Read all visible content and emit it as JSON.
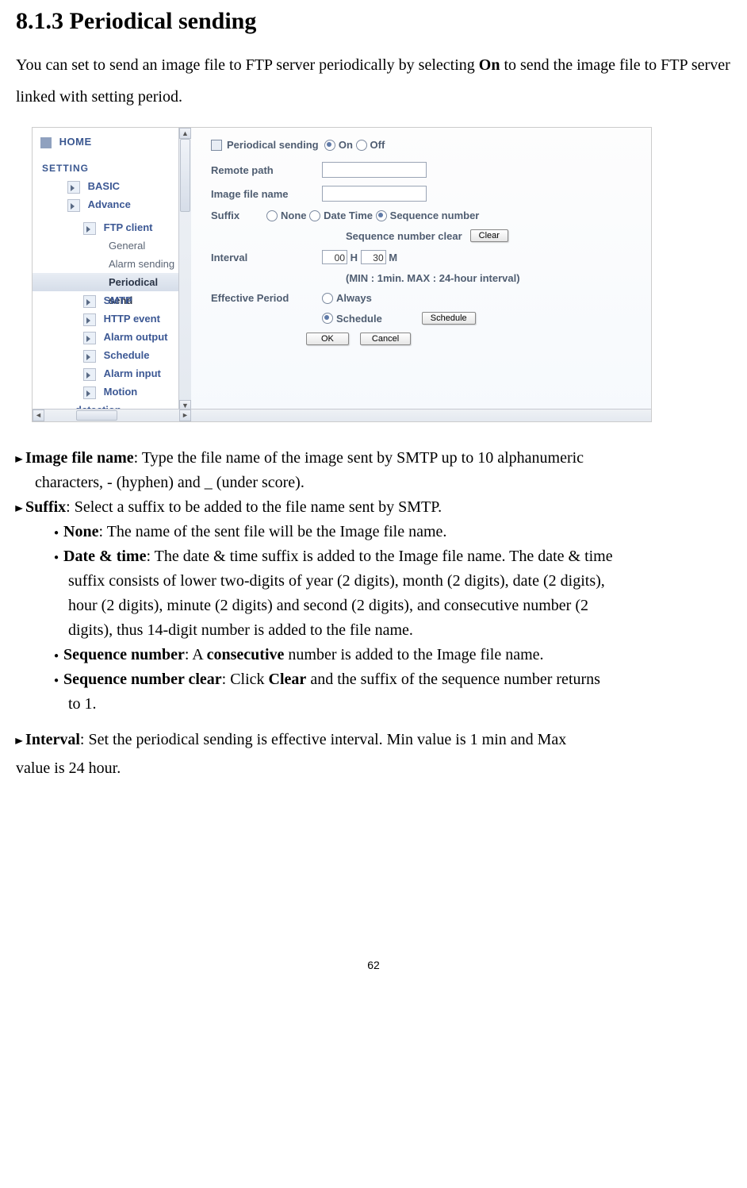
{
  "heading": "8.1.3 Periodical sending",
  "intro_parts": {
    "a": "You can set to send an image file to FTP server periodically by selecting ",
    "on": "On",
    "b": " to send the image file to FTP server linked with setting period."
  },
  "sidebar": {
    "home": "HOME",
    "setting": "SETTING",
    "basic": "BASIC",
    "advance": "Advance",
    "ftp_client": "FTP client",
    "general": "General",
    "alarm_sending": "Alarm sending",
    "periodical": "Periodical send",
    "smtp": "SMTP",
    "http_event": "HTTP event",
    "alarm_output": "Alarm output",
    "schedule": "Schedule",
    "alarm_input": "Alarm input",
    "motion": "Motion detection"
  },
  "content": {
    "title": "Periodical sending",
    "on": "On",
    "off": "Off",
    "remote_path": "Remote path",
    "image_file_name": "Image file name",
    "suffix": "Suffix",
    "none": "None",
    "date_time": "Date Time",
    "sequence_number": "Sequence number",
    "seq_clear_label": "Sequence number clear",
    "clear_btn": "Clear",
    "interval": "Interval",
    "h": "H",
    "m": "M",
    "hours_val": "00",
    "mins_val": "30",
    "range_hint": "(MIN : 1min. MAX : 24-hour interval)",
    "effective_period": "Effective Period",
    "always": "Always",
    "schedule": "Schedule",
    "schedule_btn": "Schedule",
    "ok": "OK",
    "cancel": "Cancel"
  },
  "desc": {
    "image_file_name_b": "Image file name",
    "image_file_name_t1": ": Type the file name of the image sent by SMTP up to 10 alphanumeric",
    "image_file_name_t2": "characters, - (hyphen) and _ (under score).",
    "suffix_b": "Suffix",
    "suffix_t": ": Select a suffix to be added to the file name sent by SMTP.",
    "none_b": "None",
    "none_t": ": The name of the sent file will be the Image file name.",
    "dt_b": "Date & time",
    "dt_t1": ": The date & time suffix is added to the Image file name. The date & time",
    "dt_t2": "suffix consists of lower two-digits of year (2 digits), month (2 digits), date (2 digits),",
    "dt_t3": "hour (2 digits), minute (2 digits) and second (2 digits), and consecutive number (2",
    "dt_t4": "digits), thus 14-digit number is added to the file name.",
    "seq_b": "Sequence number",
    "seq_t1a": ": A ",
    "seq_t1b": "consecutive",
    "seq_t1c": " number is added to the Image file name.",
    "seqc_b": "Sequence number clear",
    "seqc_t1a": ": Click ",
    "seqc_t1b": "Clear",
    "seqc_t1c": " and the suffix of the sequence number returns",
    "seqc_t2": "to 1.",
    "interval_b": "Interval",
    "interval_t1": ": Set the periodical sending is effective interval. Min value is 1 min and Max",
    "interval_t2": "value is 24 hour."
  },
  "page_number": "62"
}
